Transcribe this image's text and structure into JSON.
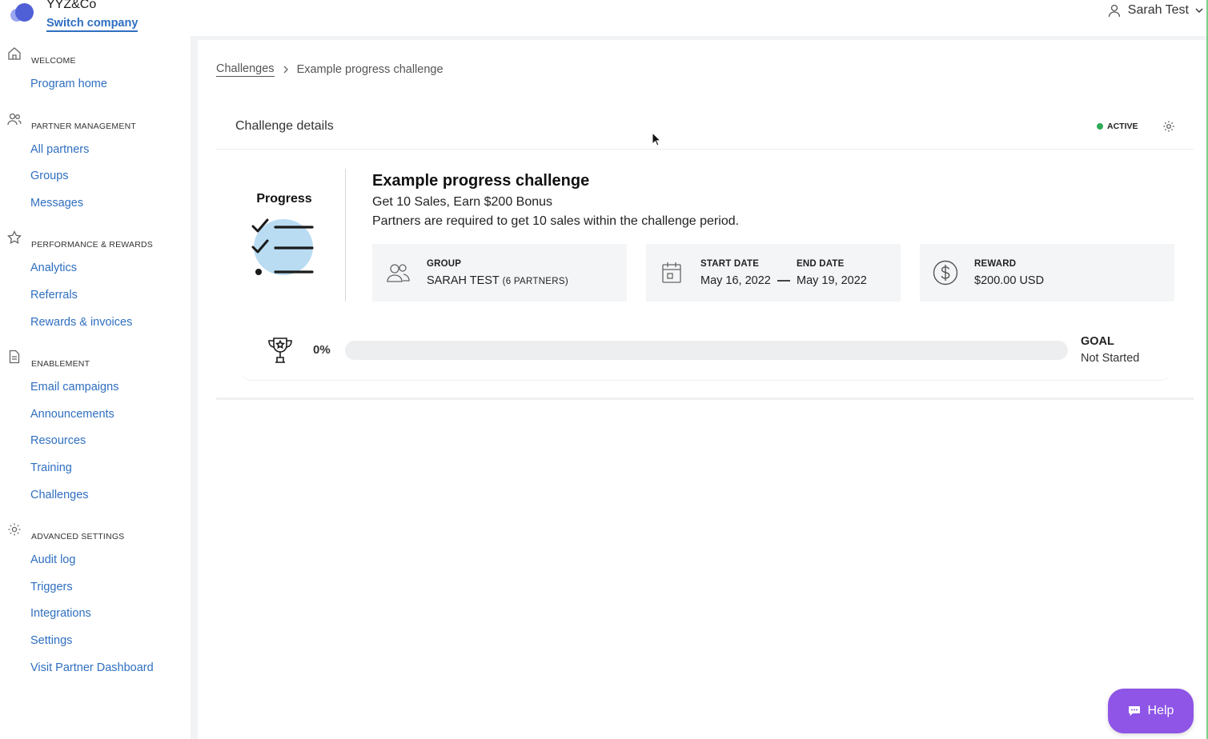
{
  "header": {
    "company_name": "YYZ&Co",
    "switch_company_label": "Switch company",
    "user_name": "Sarah Test"
  },
  "sidebar": {
    "sections": [
      {
        "title": "WELCOME",
        "icon": "home-icon",
        "items": [
          "Program home"
        ]
      },
      {
        "title": "PARTNER MANAGEMENT",
        "icon": "people-icon",
        "items": [
          "All partners",
          "Groups",
          "Messages"
        ]
      },
      {
        "title": "PERFORMANCE & REWARDS",
        "icon": "star-icon",
        "items": [
          "Analytics",
          "Referrals",
          "Rewards & invoices"
        ]
      },
      {
        "title": "ENABLEMENT",
        "icon": "document-icon",
        "items": [
          "Email campaigns",
          "Announcements",
          "Resources",
          "Training",
          "Challenges"
        ]
      },
      {
        "title": "ADVANCED SETTINGS",
        "icon": "gear-icon",
        "items": [
          "Audit log",
          "Triggers",
          "Integrations",
          "Settings",
          "Visit Partner Dashboard"
        ]
      }
    ]
  },
  "breadcrumb": {
    "parent": "Challenges",
    "current": "Example progress challenge"
  },
  "card": {
    "title": "Challenge details",
    "status": "ACTIVE",
    "status_color": "#2eaa57",
    "challenge_type": "Progress",
    "challenge_title": "Example progress challenge",
    "subtitle": "Get 10 Sales, Earn $200 Bonus",
    "description": "Partners are required to get 10 sales within the challenge period.",
    "group": {
      "label": "GROUP",
      "value": "SARAH TEST",
      "partners": "(6 PARTNERS)"
    },
    "dates": {
      "start_label": "START DATE",
      "start_value": "May 16, 2022",
      "end_label": "END DATE",
      "end_value": "May 19, 2022"
    },
    "reward": {
      "label": "REWARD",
      "value": "$200.00 USD"
    },
    "progress": {
      "percent_text": "0%",
      "fraction": 0,
      "goal_label": "GOAL",
      "goal_value": "Not Started"
    }
  },
  "help_button": {
    "label": "Help",
    "color": "#8e55e6"
  },
  "colors": {
    "link": "#2f6fc0",
    "brand": "#4f5fd6"
  }
}
